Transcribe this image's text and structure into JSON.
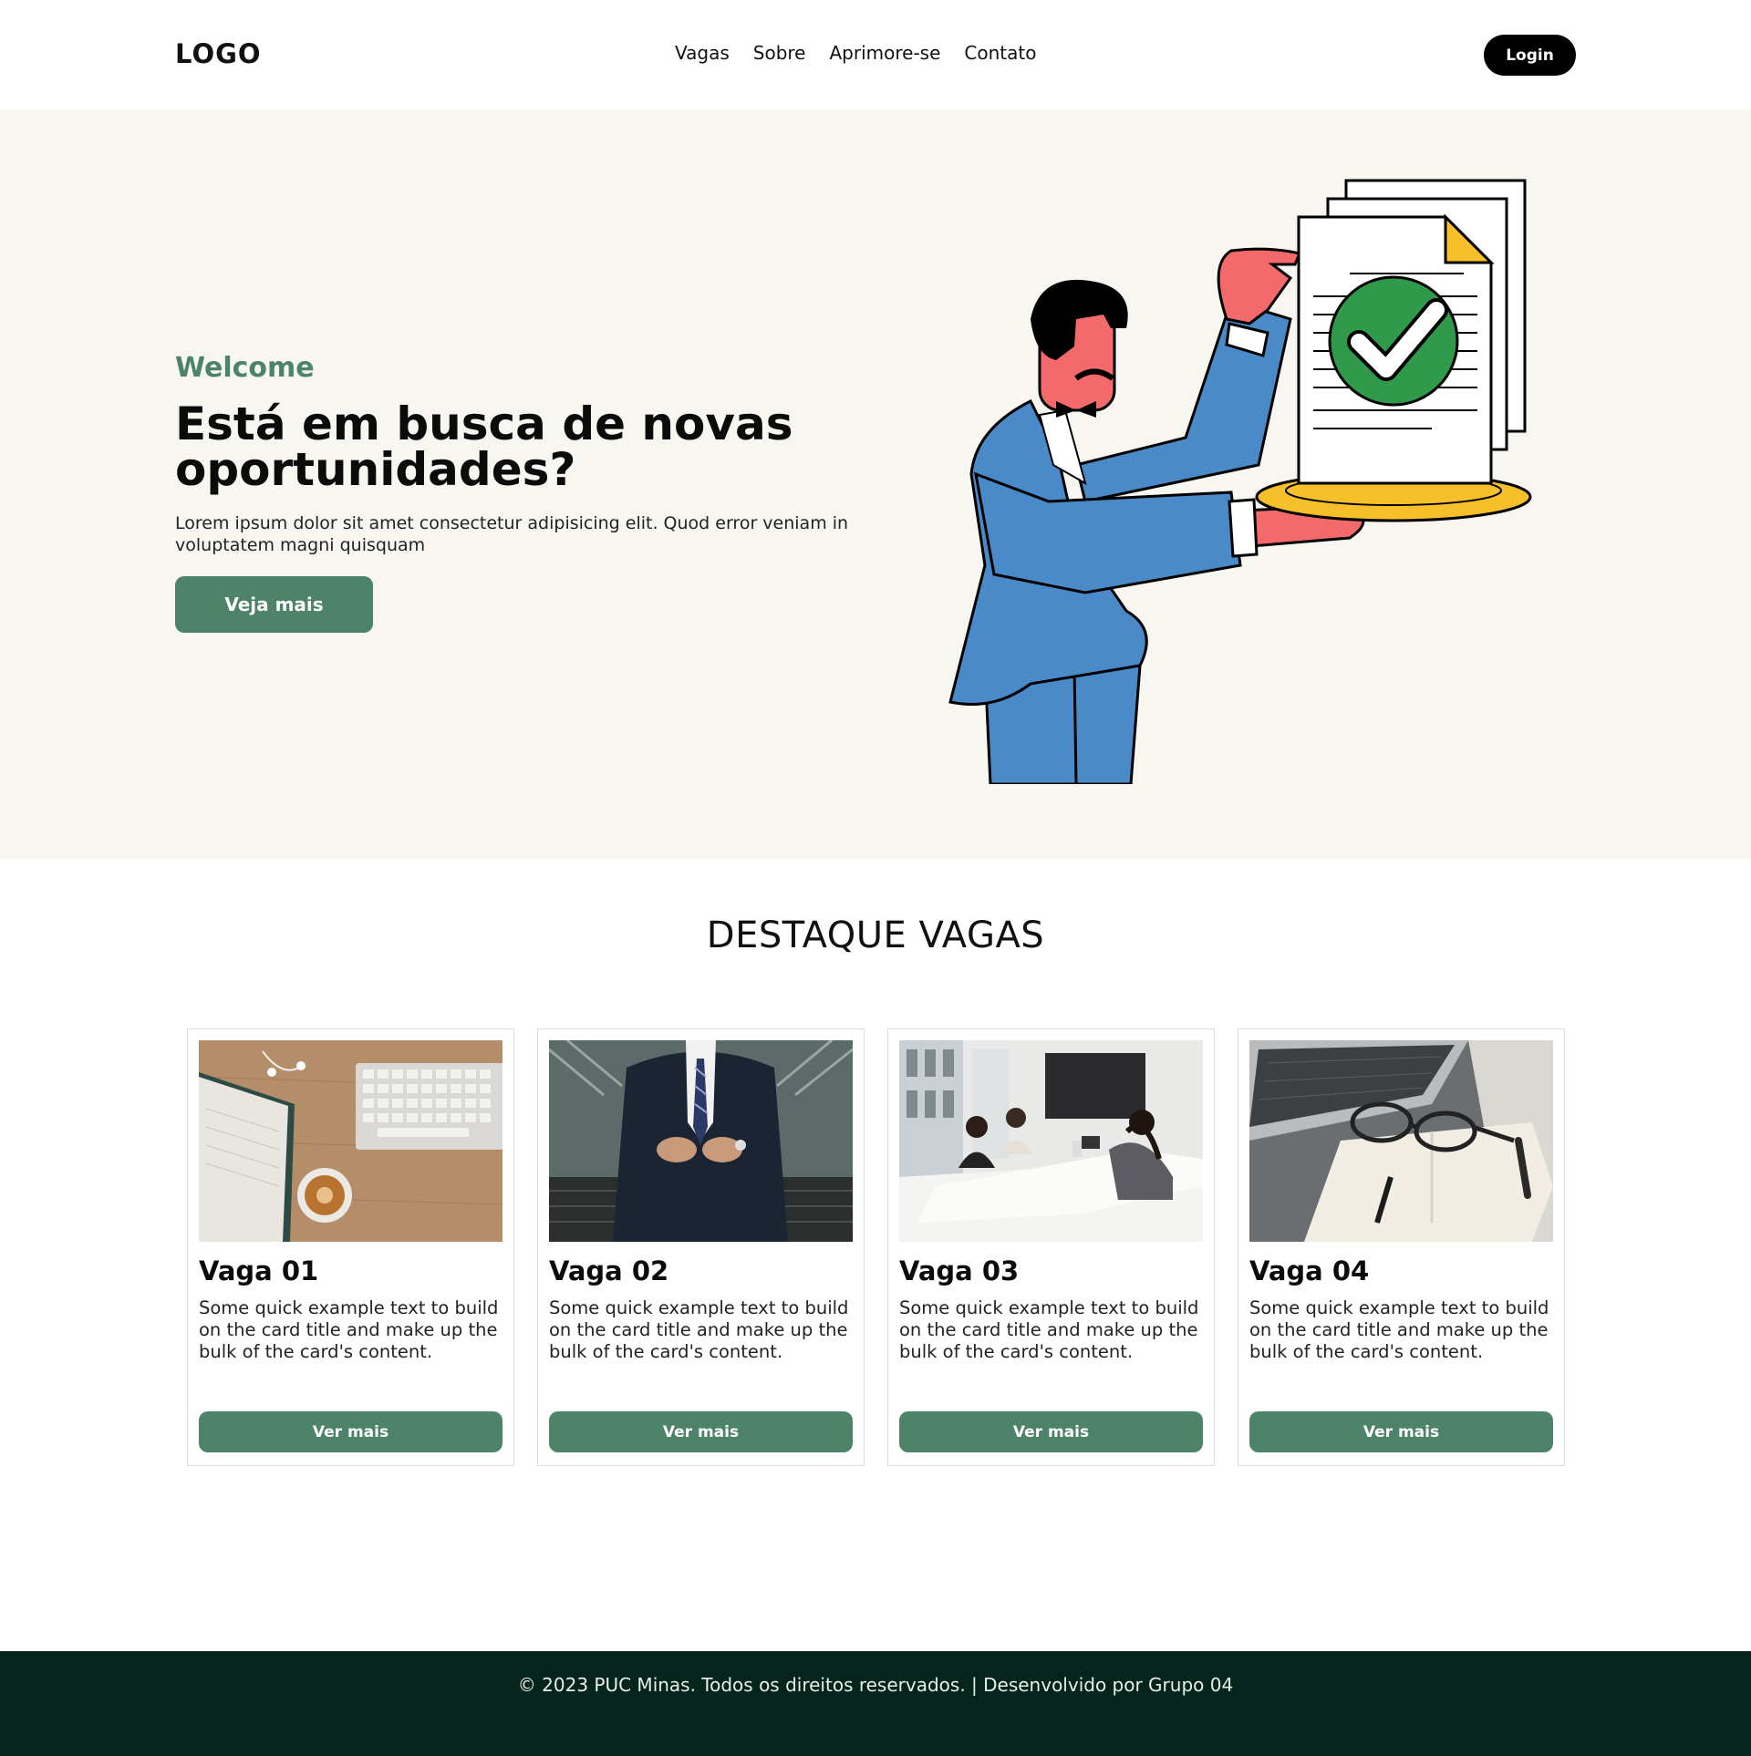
{
  "navbar": {
    "logo": "LOGO",
    "links": [
      "Vagas",
      "Sobre",
      "Aprimore-se",
      "Contato"
    ],
    "login_label": "Login"
  },
  "hero": {
    "eyebrow": "Welcome",
    "title": "Está em busca de novas oportunidades?",
    "text": "Lorem ipsum dolor sit amet consectetur adipisicing elit. Quod error veniam in voluptatem magni quisquam",
    "button_label": "Veja mais",
    "illustration": "man-holding-approved-document-illustration"
  },
  "featured": {
    "title": "DESTAQUE VAGAS",
    "cards": [
      {
        "title": "Vaga 01",
        "text": "Some quick example text to build on the card title and make up the bulk of the card's content.",
        "button": "Ver mais",
        "image": "desk-keyboard-coffee-photo"
      },
      {
        "title": "Vaga 02",
        "text": "Some quick example text to build on the card title and make up the bulk of the card's content.",
        "button": "Ver mais",
        "image": "businessman-suit-photo"
      },
      {
        "title": "Vaga 03",
        "text": "Some quick example text to build on the card title and make up the bulk of the card's content.",
        "button": "Ver mais",
        "image": "office-meeting-photo"
      },
      {
        "title": "Vaga 04",
        "text": "Some quick example text to build on the card title and make up the bulk of the card's content.",
        "button": "Ver mais",
        "image": "laptop-glasses-notebook-photo"
      }
    ]
  },
  "footer": {
    "text": "© 2023 PUC Minas. Todos os direitos reservados. | Desenvolvido por Grupo 04"
  },
  "colors": {
    "accent_green": "#4d8469",
    "hero_bg": "#f8f6f1",
    "footer_bg": "#05241c",
    "login_bg": "#000000"
  }
}
